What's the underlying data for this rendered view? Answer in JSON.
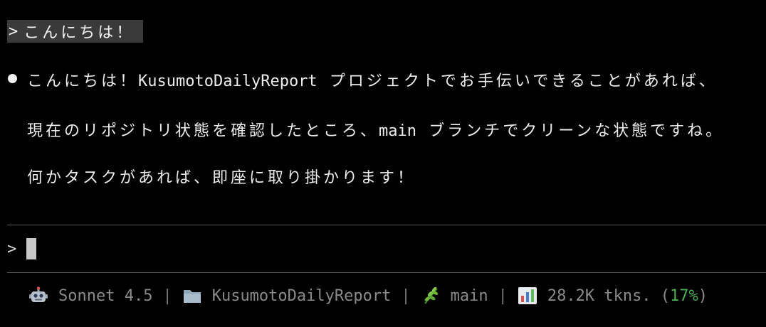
{
  "conversation": {
    "user_message": {
      "prompt_symbol": ">",
      "text": "こんにちは！"
    },
    "assistant_reply": {
      "lines": [
        {
          "prefix": "こんにちは！",
          "ascii": "KusumotoDailyReport",
          "suffix": " プロジェクトでお手伝いできることがあれば、"
        },
        {
          "prefix": "現在のリポジトリ状態を確認したところ、",
          "ascii": "main",
          "suffix": " ブランチでクリーンな状態ですね。"
        },
        {
          "prefix": "何かタスクがあれば、即座に取り掛かります！",
          "ascii": "",
          "suffix": ""
        }
      ]
    }
  },
  "input": {
    "prompt_symbol": ">"
  },
  "status_bar": {
    "model_icon": "robot-icon",
    "model": "Sonnet 4.5",
    "separator": "|",
    "folder_icon": "folder-icon",
    "project": "KusumotoDailyReport",
    "branch_icon": "herb-icon",
    "branch": "main",
    "tokens_icon": "bar-chart-icon",
    "tokens": "28.2K tkns. (",
    "percent": "17%",
    "close_paren": ")"
  },
  "colors": {
    "background": "#000000",
    "user_highlight": "#3a3a3a",
    "accent_green": "#4caf50",
    "muted_text": "#8a8a8a"
  }
}
